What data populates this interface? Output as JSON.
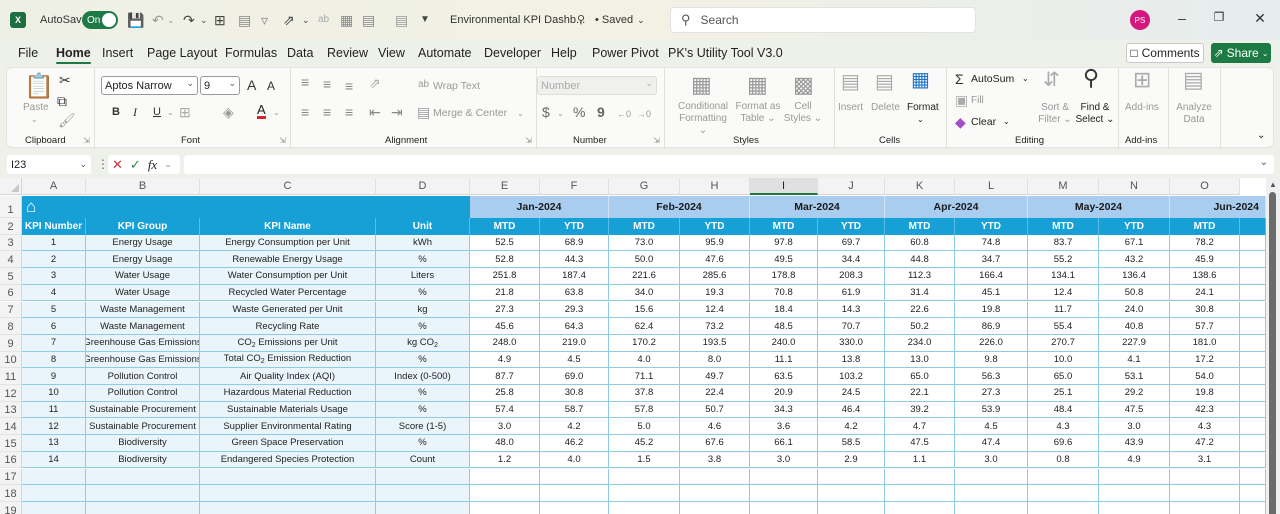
{
  "titlebar": {
    "app_icon": "excel-icon",
    "autosave_label": "AutoSave",
    "autosave_state": "On",
    "doc_title": "Environmental KPI Dashb...",
    "saved_status": "• Saved",
    "search_placeholder": "Search",
    "avatar_initials": "PS",
    "accent": "#1e7a45"
  },
  "menu": {
    "tabs": [
      "File",
      "Home",
      "Insert",
      "Page Layout",
      "Formulas",
      "Data",
      "Review",
      "View",
      "Automate",
      "Developer",
      "Help",
      "Power Pivot",
      "PK's Utility Tool V3.0"
    ],
    "active": "Home",
    "comments_label": "Comments",
    "share_label": "Share"
  },
  "ribbon": {
    "clipboard": {
      "paste": "Paste",
      "label": "Clipboard"
    },
    "font": {
      "name": "Aptos Narrow",
      "size": "9",
      "bold": "B",
      "italic": "I",
      "underline": "U",
      "label": "Font",
      "grow": "A",
      "shrink": "A",
      "font_color": "A"
    },
    "alignment": {
      "wrap": "Wrap Text",
      "merge": "Merge & Center",
      "label": "Alignment"
    },
    "number": {
      "format": "Number",
      "currency": "$",
      "percent": "%",
      "comma": "9",
      "label": "Number"
    },
    "styles": {
      "conditional": [
        "Conditional",
        "Formatting"
      ],
      "format_table": [
        "Format as",
        "Table"
      ],
      "cell_styles": [
        "Cell",
        "Styles"
      ],
      "label": "Styles"
    },
    "cells": {
      "insert": "Insert",
      "delete": "Delete",
      "format": "Format",
      "label": "Cells"
    },
    "editing": {
      "autosum": "AutoSum",
      "fill": "Fill",
      "clear": "Clear",
      "sort": [
        "Sort &",
        "Filter"
      ],
      "find": [
        "Find &",
        "Select"
      ],
      "label": "Editing"
    },
    "addins": {
      "addins": "Add-ins",
      "label": "Add-ins"
    },
    "analyze": {
      "label": [
        "Analyze",
        "Data"
      ]
    }
  },
  "formula_bar": {
    "name_box": "I23",
    "formula": ""
  },
  "sheet": {
    "columns": [
      "A",
      "B",
      "C",
      "D",
      "E",
      "F",
      "G",
      "H",
      "I",
      "J",
      "K",
      "L",
      "M",
      "N",
      "O"
    ],
    "selected_column": "I",
    "row_numbers": [
      "1",
      "2",
      "3",
      "4",
      "5",
      "6",
      "7",
      "8",
      "9",
      "10",
      "11",
      "12",
      "13",
      "14",
      "15",
      "16",
      "17",
      "18",
      "19"
    ],
    "months": [
      "Jan-2024",
      "Feb-2024",
      "Mar-2024",
      "Apr-2024",
      "May-2024",
      "Jun-2024"
    ],
    "header": {
      "kpi_number": "KPI Number",
      "kpi_group": "KPI Group",
      "kpi_name": "KPI Name",
      "unit": "Unit",
      "mtd": "MTD",
      "ytd": "YTD"
    },
    "rows": [
      {
        "num": "1",
        "group": "Energy Usage",
        "name": "Energy Consumption per Unit",
        "unit": "kWh",
        "values": [
          "52.5",
          "68.9",
          "73.0",
          "95.9",
          "97.8",
          "69.7",
          "60.8",
          "74.8",
          "83.7",
          "67.1",
          "78.2"
        ]
      },
      {
        "num": "2",
        "group": "Energy Usage",
        "name": "Renewable Energy Usage",
        "unit": "%",
        "values": [
          "52.8",
          "44.3",
          "50.0",
          "47.6",
          "49.5",
          "34.4",
          "44.8",
          "34.7",
          "55.2",
          "43.2",
          "45.9"
        ]
      },
      {
        "num": "3",
        "group": "Water Usage",
        "name": "Water Consumption per Unit",
        "unit": "Liters",
        "values": [
          "251.8",
          "187.4",
          "221.6",
          "285.6",
          "178.8",
          "208.3",
          "112.3",
          "166.4",
          "134.1",
          "136.4",
          "138.6"
        ]
      },
      {
        "num": "4",
        "group": "Water Usage",
        "name": "Recycled Water Percentage",
        "unit": "%",
        "values": [
          "21.8",
          "63.8",
          "34.0",
          "19.3",
          "70.8",
          "61.9",
          "31.4",
          "45.1",
          "12.4",
          "50.8",
          "24.1"
        ]
      },
      {
        "num": "5",
        "group": "Waste Management",
        "name": "Waste Generated per Unit",
        "unit": "kg",
        "values": [
          "27.3",
          "29.3",
          "15.6",
          "12.4",
          "18.4",
          "14.3",
          "22.6",
          "19.8",
          "11.7",
          "24.0",
          "30.8"
        ]
      },
      {
        "num": "6",
        "group": "Waste Management",
        "name": "Recycling Rate",
        "unit": "%",
        "values": [
          "45.6",
          "64.3",
          "62.4",
          "73.2",
          "48.5",
          "70.7",
          "50.2",
          "86.9",
          "55.4",
          "40.8",
          "57.7"
        ]
      },
      {
        "num": "7",
        "group": "Greenhouse Gas Emissions",
        "name": "CO₂ Emissions per Unit",
        "unit": "kg CO₂",
        "values": [
          "248.0",
          "219.0",
          "170.2",
          "193.5",
          "240.0",
          "330.0",
          "234.0",
          "226.0",
          "270.7",
          "227.9",
          "181.0"
        ]
      },
      {
        "num": "8",
        "group": "Greenhouse Gas Emissions",
        "name": "Total CO₂ Emission Reduction",
        "unit": "%",
        "values": [
          "4.9",
          "4.5",
          "4.0",
          "8.0",
          "11.1",
          "13.8",
          "13.0",
          "9.8",
          "10.0",
          "4.1",
          "17.2"
        ]
      },
      {
        "num": "9",
        "group": "Pollution Control",
        "name": "Air Quality Index (AQI)",
        "unit": "Index (0-500)",
        "values": [
          "87.7",
          "69.0",
          "71.1",
          "49.7",
          "63.5",
          "103.2",
          "65.0",
          "56.3",
          "65.0",
          "53.1",
          "54.0"
        ]
      },
      {
        "num": "10",
        "group": "Pollution Control",
        "name": "Hazardous Material Reduction",
        "unit": "%",
        "values": [
          "25.8",
          "30.8",
          "37.8",
          "22.4",
          "20.9",
          "24.5",
          "22.1",
          "27.3",
          "25.1",
          "29.2",
          "19.8"
        ]
      },
      {
        "num": "11",
        "group": "Sustainable Procurement",
        "name": "Sustainable Materials Usage",
        "unit": "%",
        "values": [
          "57.4",
          "58.7",
          "57.8",
          "50.7",
          "34.3",
          "46.4",
          "39.2",
          "53.9",
          "48.4",
          "47.5",
          "42.3"
        ]
      },
      {
        "num": "12",
        "group": "Sustainable Procurement",
        "name": "Supplier Environmental Rating",
        "unit": "Score (1-5)",
        "values": [
          "3.0",
          "4.2",
          "5.0",
          "4.6",
          "3.6",
          "4.2",
          "4.7",
          "4.5",
          "4.3",
          "3.0",
          "4.3"
        ]
      },
      {
        "num": "13",
        "group": "Biodiversity",
        "name": "Green Space Preservation",
        "unit": "%",
        "values": [
          "48.0",
          "46.2",
          "45.2",
          "67.6",
          "66.1",
          "58.5",
          "47.5",
          "47.4",
          "69.6",
          "43.9",
          "47.2"
        ]
      },
      {
        "num": "14",
        "group": "Biodiversity",
        "name": "Endangered Species Protection",
        "unit": "Count",
        "values": [
          "1.2",
          "4.0",
          "1.5",
          "3.8",
          "3.0",
          "2.9",
          "1.1",
          "3.0",
          "0.8",
          "4.9",
          "3.1"
        ]
      }
    ],
    "colors": {
      "header_blue": "#16a0d6",
      "month_band": "#a9cdef",
      "body_tint": "#eaf5fb",
      "grid_line": "#8fcbe6"
    }
  }
}
